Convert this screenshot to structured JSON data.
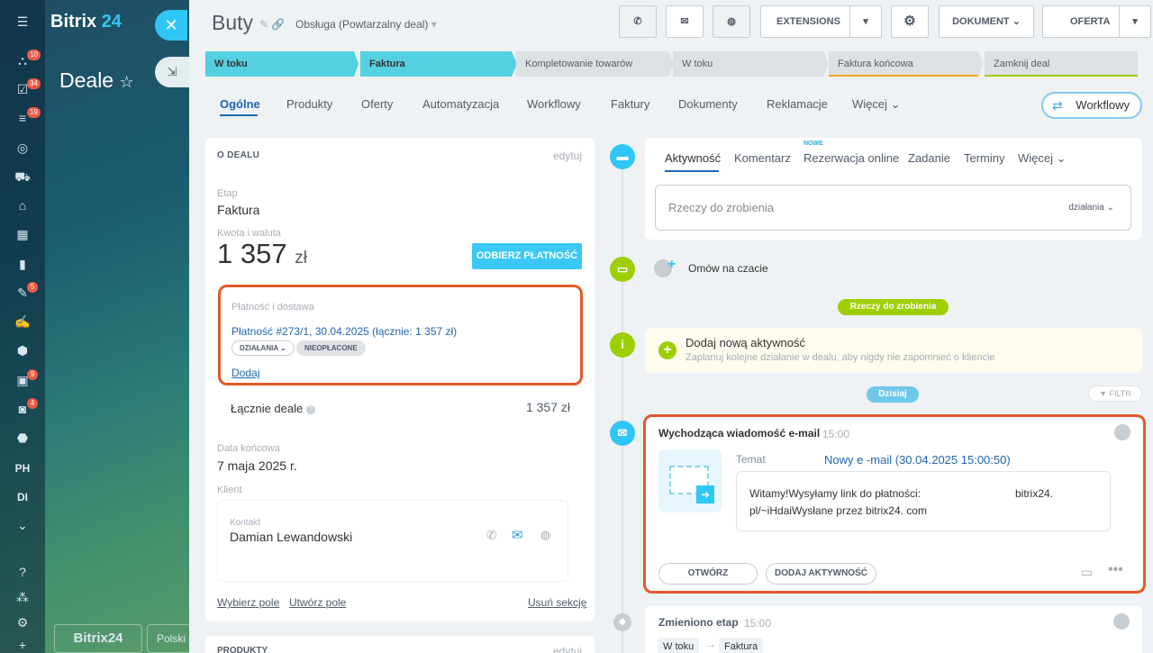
{
  "sidebar": {
    "logo_main": "Bitrix",
    "logo_num": "24",
    "page_title": "Deale",
    "badges": [
      "10",
      "34",
      "19",
      "5",
      "9",
      "4"
    ],
    "rail_text": [
      "PH",
      "DI"
    ],
    "bottom_logo": "Bitrix24",
    "bottom_lang": "Polski"
  },
  "header": {
    "title": "Buty",
    "pipeline": "Obsługa (Powtarzalny deal)",
    "buttons": {
      "extensions": "EXTENSIONS",
      "dokument": "DOKUMENT",
      "oferta": "OFERTA"
    }
  },
  "stages": [
    {
      "label": "W toku",
      "done": true
    },
    {
      "label": "Faktura",
      "done": true
    },
    {
      "label": "Kompletowanie towarów",
      "done": false
    },
    {
      "label": "W toku",
      "done": false
    },
    {
      "label": "Faktura końcowa",
      "done": false
    },
    {
      "label": "Zamknij deal",
      "done": false
    }
  ],
  "tabs": [
    "Ogólne",
    "Produkty",
    "Oferty",
    "Automatyzacja",
    "Workflowy",
    "Faktury",
    "Dokumenty",
    "Reklamacje",
    "Więcej"
  ],
  "workflow_button": "Workflowy",
  "deal": {
    "section_title": "O DEALU",
    "edit": "edytuj",
    "stage_label": "Etap",
    "stage_value": "Faktura",
    "amount_label": "Kwota i waluta",
    "amount": "1 357",
    "currency": "zł",
    "pay_button": "ODBIERZ PŁATNOŚĆ",
    "payment_label": "Płatność i dostawa",
    "payment_link": "Płatność #273/1, 30.04.2025 (łącznie: 1 357 zł)",
    "pill_actions": "DZIAŁANIA",
    "pill_unpaid": "NIEOPŁACONE",
    "add": "Dodaj",
    "total_label": "Łącznie deale",
    "total_value": "1 357 zł",
    "close_date_label": "Data końcowa",
    "close_date": "7 maja 2025 r.",
    "client_label": "Klient",
    "contact_label": "Kontakt",
    "contact_name": "Damian Lewandowski",
    "select_field": "Wybierz pole",
    "create_field": "Utwórz pole",
    "delete_section": "Usuń sekcję",
    "products_title": "PRODUKTY",
    "products_edit": "edytuj"
  },
  "activity": {
    "tabs": [
      "Aktywność",
      "Komentarz",
      "Rezerwacja online",
      "Zadanie",
      "Terminy",
      "Więcej"
    ],
    "new_badge": "NOWE",
    "input_placeholder": "Rzeczy do zrobienia",
    "actions": "działania",
    "chat": "Omów na czacie",
    "todo_badge": "Rzeczy do zrobienia",
    "new_activity_title": "Dodaj nową aktywność",
    "new_activity_sub": "Zaplanuj kolejne działanie w dealu, aby nigdy nie zapomnieć o kliencie",
    "today": "Dzisiaj",
    "filter": "FILTR"
  },
  "email": {
    "title": "Wychodząca wiadomość e-mail",
    "time": "15:00",
    "subject_label": "Temat",
    "subject": "Nowy e -mail (30.04.2025 15:00:50)",
    "body_line1": "Witamy!Wysyłamy link do płatności:",
    "body_link": "bitrix24.",
    "body_line2": "pl/~iHdaiWysłane przez bitrix24. com",
    "open": "OTWÓRZ",
    "add_activity": "DODAJ AKTYWNOŚĆ"
  },
  "stage_change": {
    "title": "Zmieniono etap",
    "time": "15:00",
    "from": "W toku",
    "to": "Faktura"
  }
}
